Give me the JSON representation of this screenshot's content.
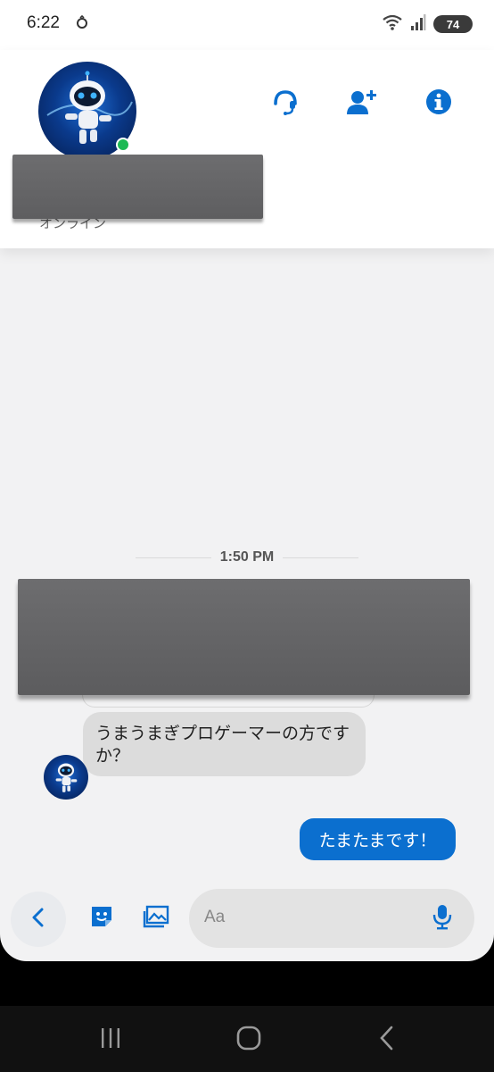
{
  "status_bar": {
    "time": "6:22",
    "battery": "74",
    "icons": [
      "notification-icon",
      "wifi-icon",
      "signal-icon",
      "battery-icon"
    ]
  },
  "header": {
    "status_text": "オンライン",
    "actions": [
      "headset-icon",
      "add-friend-icon",
      "info-icon"
    ],
    "online_color": "#1db954"
  },
  "chat": {
    "timestamp": "1:50 PM",
    "incoming_message": "うまうまぎプロゲーマーの方ですか？",
    "outgoing_message": "たまたまです！"
  },
  "composer": {
    "placeholder": "Aa",
    "buttons": [
      "back-icon",
      "sticker-icon",
      "image-icon",
      "mic-icon"
    ]
  },
  "colors": {
    "accent": "#0b6fcf",
    "incoming_bubble": "#dcdcdc",
    "background": "#f2f2f3"
  }
}
